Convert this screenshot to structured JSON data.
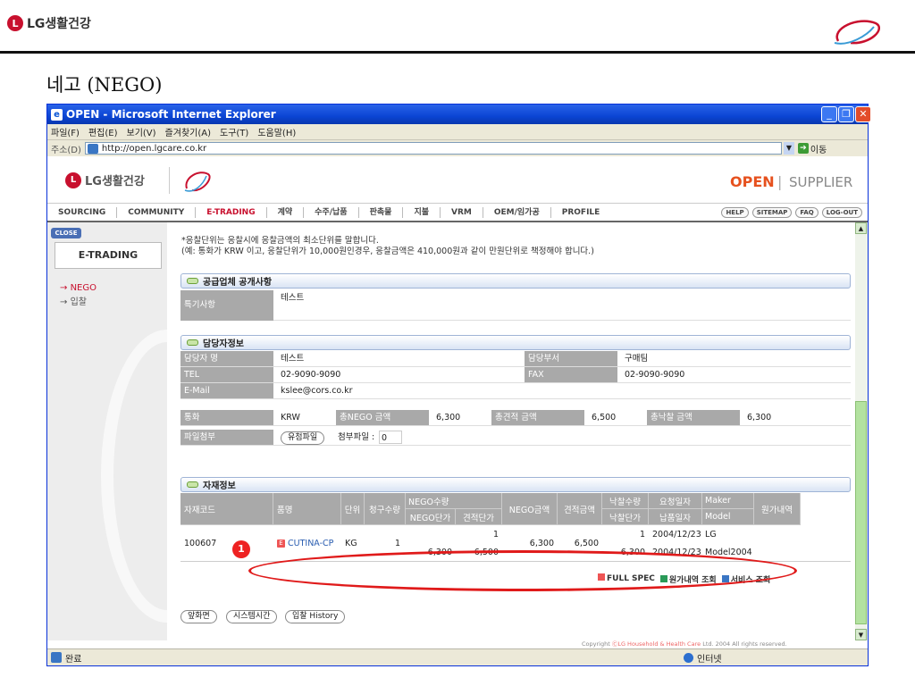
{
  "slide": {
    "brand": "LG생활건강",
    "title": "네고 (NEGO)",
    "corner_logo_alt": "Clean & Beautiful"
  },
  "window": {
    "title": "OPEN - Microsoft Internet Explorer"
  },
  "menubar": [
    "파일(F)",
    "편집(E)",
    "보기(V)",
    "즐겨찾기(A)",
    "도구(T)",
    "도움말(H)"
  ],
  "address": {
    "label": "주소(D)",
    "url": "http://open.lgcare.co.kr",
    "go": "이동"
  },
  "site": {
    "brand": "LG생활건강",
    "open": "OPEN",
    "sep": "|",
    "supplier": "SUPPLIER"
  },
  "gnb": [
    "SOURCING",
    "COMMUNITY",
    "E-TRADING",
    "계약",
    "수주/납품",
    "판촉물",
    "지불",
    "VRM",
    "OEM/임가공",
    "PROFILE"
  ],
  "util": [
    "HELP",
    "SITEMAP",
    "FAQ",
    "LOG-OUT"
  ],
  "sidebar": {
    "close": "CLOSE",
    "section": "E-TRADING",
    "items": [
      "NEGO",
      "입찰"
    ]
  },
  "notes": {
    "line1": "*응찰단위는 응찰시에 응찰금액의 최소단위를 말합니다.",
    "line2": "(예: 통화가 KRW 이고, 응찰단위가 10,000원인경우, 응찰금액은 410,000원과 같이 만원단위로 책정해야 합니다.)"
  },
  "supplier_notice": {
    "header": "공급업체 공개사항",
    "label": "특기사항",
    "value": "테스트"
  },
  "contact": {
    "header": "담당자정보",
    "name_label": "담당자 명",
    "name": "테스트",
    "dept_label": "담당부서",
    "dept": "구매팀",
    "tel_label": "TEL",
    "tel": "02-9090-9090",
    "fax_label": "FAX",
    "fax": "02-9090-9090",
    "email_label": "E-Mail",
    "email": "kslee@cors.co.kr"
  },
  "amounts": {
    "currency_label": "통화",
    "currency": "KRW",
    "nego_label": "총NEGO 금액",
    "nego": "6,300",
    "quote_label": "총견적 금액",
    "quote": "6,500",
    "award_label": "총낙찰 금액",
    "award": "6,300",
    "file_label": "파일첨부",
    "file_btn": "유첨파일",
    "attach_label": "첨부파일 :",
    "attach_count": "0"
  },
  "materials": {
    "header": "자재정보",
    "cols": {
      "code": "자재코드",
      "name": "품명",
      "unit": "단위",
      "req_qty": "청구수량",
      "nego_qty": "NEGO수량",
      "nego_price": "NEGO단가",
      "quote_price": "견적단가",
      "nego_amt": "NEGO금액",
      "quote_amt": "견적금액",
      "award_qty": "낙찰수량",
      "award_price": "낙찰단가",
      "req_date": "요청일자",
      "deliv_date": "납품일자",
      "maker": "Maker",
      "model": "Model",
      "cost": "원가내역"
    },
    "row": {
      "code": "100607",
      "name": "CUTINA-CP",
      "unit": "KG",
      "req_qty": "1",
      "nego_qty": "1",
      "nego_price": "6,300",
      "quote_price": "6,500",
      "nego_amt": "6,300",
      "quote_amt": "6,500",
      "award_qty": "1",
      "award_price": "6,300",
      "req_date": "2004/12/23",
      "deliv_date": "2004/12/23",
      "maker": "LG",
      "model": "Model2004"
    },
    "links": [
      "FULL SPEC",
      "원가내역 조회",
      "서비스 조회"
    ]
  },
  "buttons": [
    "앞화면",
    "시스템시간",
    "입찰 History"
  ],
  "copyright": {
    "prefix": "Copyright ",
    "brand": "ⒸLG Household & Health Care",
    "suffix": " Ltd. 2004 All rights reserved."
  },
  "status": {
    "text": "완료",
    "zone": "인터넷"
  },
  "annotation": "1",
  "colors": {
    "accent": "#c8102e",
    "open": "#e6511e",
    "ie_blue": "#0b45d4",
    "label_gray": "#a9a9a9"
  }
}
